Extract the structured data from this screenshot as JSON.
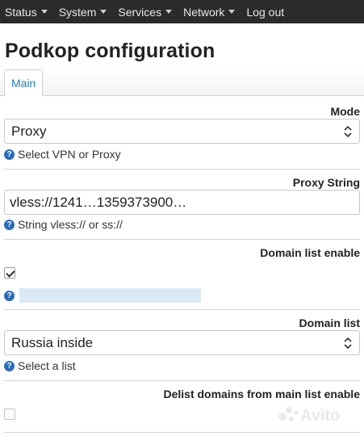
{
  "nav": {
    "items": [
      {
        "label": "Status",
        "has_caret": true
      },
      {
        "label": "System",
        "has_caret": true
      },
      {
        "label": "Services",
        "has_caret": true
      },
      {
        "label": "Network",
        "has_caret": true
      },
      {
        "label": "Log out",
        "has_caret": false
      }
    ]
  },
  "page": {
    "title": "Podkop configuration"
  },
  "tabs": [
    {
      "label": "Main",
      "active": true
    }
  ],
  "fields": {
    "mode": {
      "label": "Mode",
      "value": "Proxy",
      "hint": "Select VPN or Proxy"
    },
    "proxy_string": {
      "label": "Proxy String",
      "value": "vless://1241…1359373900…",
      "hint": "String vless:// or ss://"
    },
    "domain_list_enable": {
      "label": "Domain list enable",
      "checked": true
    },
    "domain_list": {
      "label": "Domain list",
      "value": "Russia inside",
      "hint": "Select a list"
    },
    "delist_domains": {
      "label": "Delist domains from main list enable",
      "checked": false
    }
  },
  "watermark": {
    "text": "Avito"
  },
  "colors": {
    "nav_bg": "#2b2b2b",
    "accent": "#2a7ab0",
    "help_icon": "#2a6bb8"
  }
}
